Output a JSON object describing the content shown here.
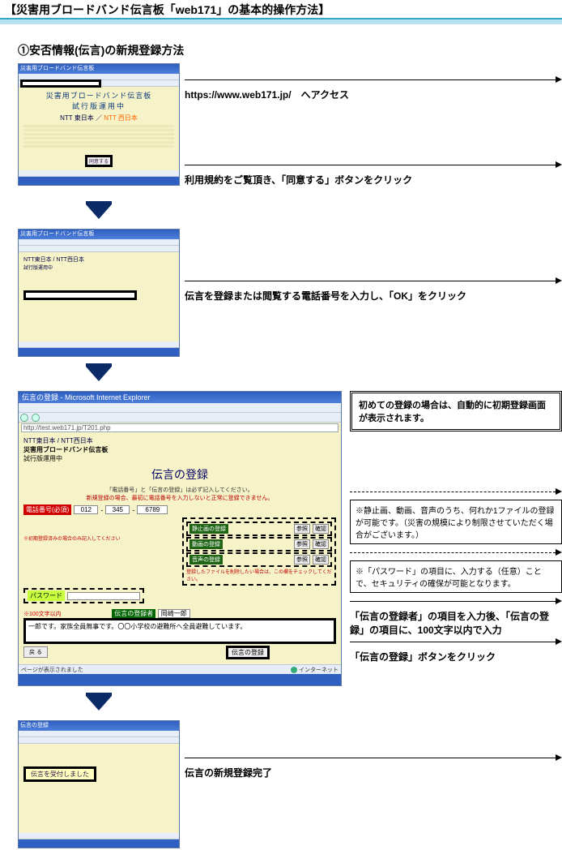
{
  "title": "【災害用ブロードバンド伝言板「web171」の基本的操作方法】",
  "section_heading": "①安否情報(伝言)の新規登録方法",
  "step1": {
    "browser_title": "災害用ブロードバンド伝言板",
    "page_heading1": "災害用ブロードバンド伝言板",
    "page_heading2": "試行版運用中",
    "logo_east": "NTT 東日本",
    "logo_west": "NTT 西日本",
    "arrow1_label": "https://www.web171.jp/　へアクセス",
    "agree_btn_caption": "同意する",
    "arrow2_label": "利用規約をご覧頂き、「同意する」ボタンをクリック"
  },
  "step2": {
    "browser_title": "災害用ブロードバンド伝言板",
    "logos": "NTT東日本 / NTT西日本",
    "logos_sub": "試行版運用中",
    "arrow_label": "伝言を登録または閲覧する電話番号を入力し、「OK」をクリック"
  },
  "step3": {
    "browser_title": "伝言の登録 - Microsoft Internet Explorer",
    "address": "http://test.web171.jp/T201.php",
    "logos": "NTT東日本 / NTT西日本",
    "sub1": "災害用ブロードバンド伝言板",
    "sub2": "試行版運用中",
    "page_h": "伝言の登録",
    "field_note": "「電話番号」と「伝言の登録」は必ず記入してください。",
    "field_note2": "新規登録の場合、最初に電話番号を入力しないと正常に登録できません。",
    "phone_label": "電話番号(必須)",
    "phone1": "012",
    "phone2": "345",
    "phone3": "6789",
    "photo_label": "静止画の登録",
    "video_label": "動画の登録",
    "audio_label": "音声の登録",
    "browse_btn": "参照",
    "confirm_btn": "確認",
    "files_note": "登録したファイルを削除したい場合は、この欄をチェックしてください。",
    "password_label": "パスワード",
    "password_note": "※初期登録済みの場合のみ記入してください",
    "limit_note": "※100文字以内",
    "registrant_label": "伝言の登録者",
    "registrant_value": "岡崎一郎",
    "message_text": "一郎です。家族全員無事です。〇〇小学校の避難所へ全員避難しています。",
    "back_btn": "戻 る",
    "submit_btn": "伝言の登録",
    "status_left": "ページが表示されました",
    "status_right": "インターネット",
    "callout_first_reg": "初めての登録の場合は、自動的に初期登録画面が表示されます。",
    "callout_media": "※静止画、動画、音声のうち、何れか1ファイルの登録が可能です。（災害の規模により制限させていただく場合がございます。）",
    "callout_password": "※「パスワード」の項目に、入力する（任意）ことで、セキュリティの確保が可能となります。",
    "callout_registrant": "「伝言の登録者」の項目を入力後、「伝言の登録」の項目に、100文字以内で入力",
    "callout_submit": "「伝言の登録」ボタンをクリック"
  },
  "step4": {
    "browser_title": "伝言の登録",
    "confirm_msg": "伝言を受付しました",
    "arrow_label": "伝言の新規登録完了"
  }
}
